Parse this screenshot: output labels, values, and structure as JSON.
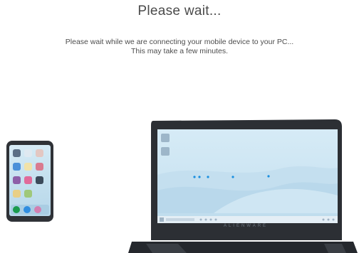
{
  "dialog": {
    "title": "Please wait...",
    "message_line1": "Please wait while we are connecting your mobile device to your PC...",
    "message_line2": "This may take a few minutes."
  },
  "laptop": {
    "brand": "ALIENWARE"
  },
  "icons": {
    "phone": "smartphone-illustration",
    "laptop": "laptop-illustration"
  },
  "colors": {
    "background": "#ffffff",
    "text": "#4a4a4a",
    "accent_dot": "#1a8fe0",
    "device_body": "#2f3237",
    "screen_bg": "#cfe7f4"
  }
}
